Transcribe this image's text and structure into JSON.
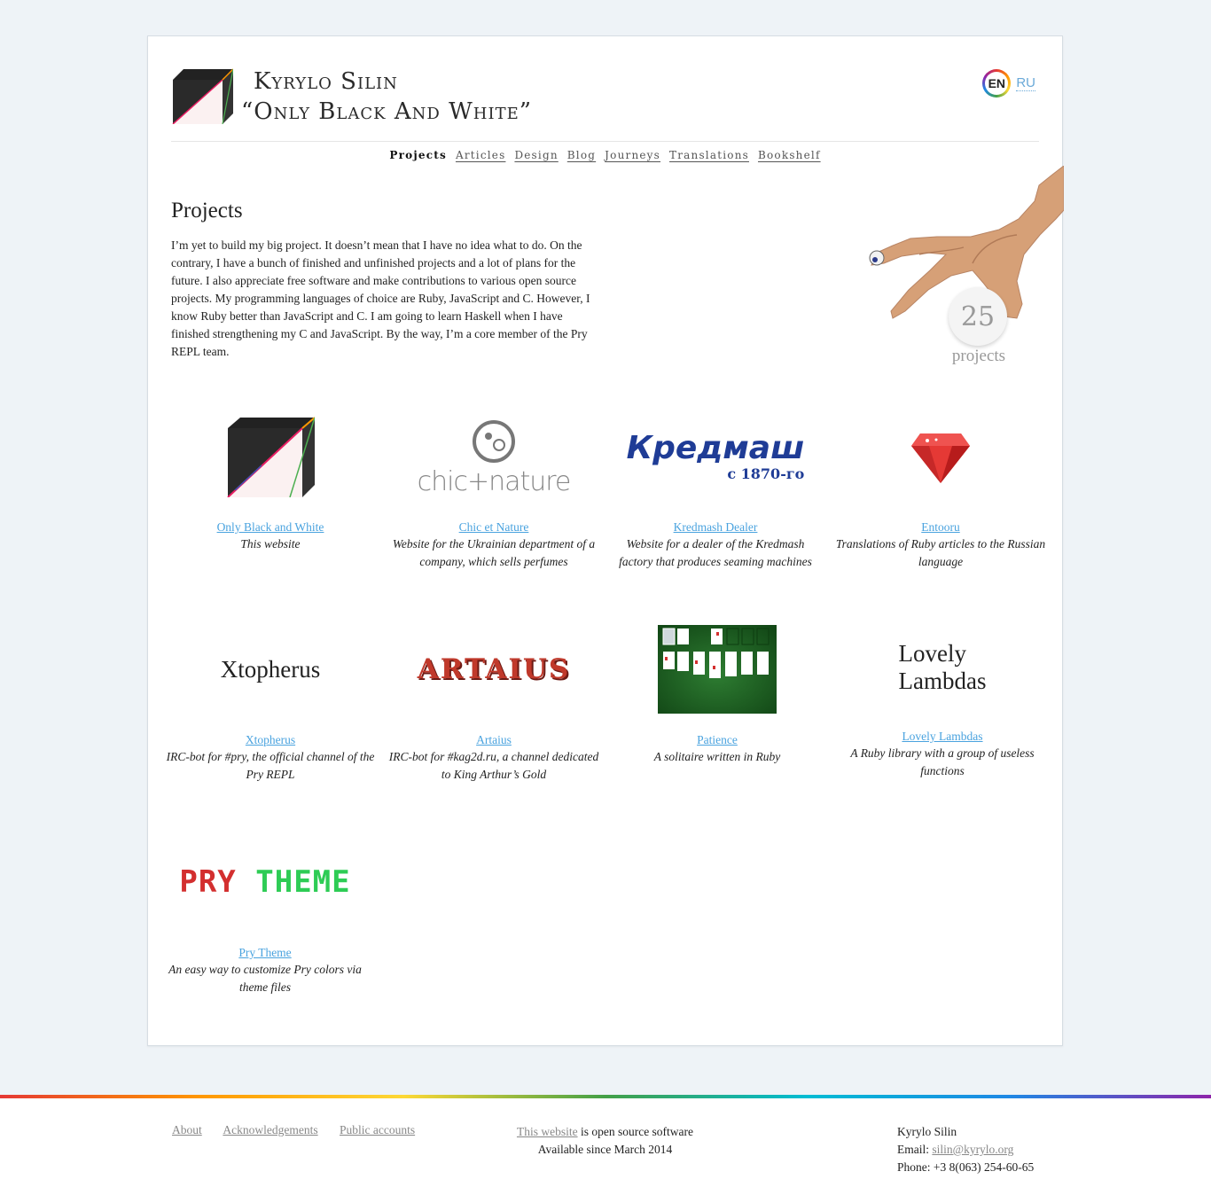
{
  "header": {
    "name": "Kyrylo Silin",
    "tagline": "“Only Black And White”",
    "lang_active": "EN",
    "lang_other": "RU"
  },
  "nav": [
    "Projects",
    "Articles",
    "Design",
    "Blog",
    "Journeys",
    "Translations",
    "Bookshelf"
  ],
  "main": {
    "title": "Projects",
    "intro": "I’m yet to build my big project. It doesn’t mean that I have no idea what to do. On the contrary, I have a bunch of finished and unfinished projects and a lot of plans for the future. I also appreciate free software and make contributions to various open source projects. My programming languages of choice are Ruby, JavaScript and C. However, I know Ruby better than JavaScript and C. I am going to learn Haskell when I have finished strengthening my C and JavaScript. By the way, I’m a core member of the Pry REPL team.",
    "project_count": "25",
    "project_count_label": "projects"
  },
  "projects": [
    {
      "title": "Only Black and White",
      "desc": "This website"
    },
    {
      "title": "Chic et Nature",
      "desc": "Website for the Ukrainian department of a company, which sells perfumes",
      "logo_text": "chic+nature"
    },
    {
      "title": "Kredmash Dealer",
      "desc": "Website for a dealer of the Kredmash factory that produces seaming machines",
      "logo_text": "Кредмаш",
      "logo_sub": "с 1870-го"
    },
    {
      "title": "Entooru",
      "desc": "Translations of Ruby articles to the Russian language"
    },
    {
      "title": "Xtopherus",
      "desc": "IRC-bot for #pry, the official channel of the Pry REPL",
      "logo_text": "Xtopherus"
    },
    {
      "title": "Artaius",
      "desc": "IRC-bot for #kag2d.ru, a channel dedicated to King Arthur’s Gold",
      "logo_text": "ARTAIUS"
    },
    {
      "title": "Patience",
      "desc": "A solitaire written in Ruby"
    },
    {
      "title": "Lovely Lambdas",
      "desc": "A Ruby library with a group of useless functions",
      "logo_line1": "Lovely",
      "logo_line2": "Lambdas"
    },
    {
      "title": "Pry Theme",
      "desc": "An easy way to customize Pry colors via theme files",
      "logo_word1": "PRY",
      "logo_word2": "THEME"
    }
  ],
  "footer": {
    "links": [
      "About",
      "Acknowledgements",
      "Public accounts"
    ],
    "source_link": "This website",
    "source_text": " is open source software",
    "since": "Available since March 2014",
    "contact_name": "Kyrylo Silin",
    "email_label": "Email: ",
    "email": "silin@kyrylo.org",
    "phone": "Phone: +3 8(063) 254-60-65"
  },
  "colors": {
    "link": "#4aa3df",
    "background": "#eef3f7",
    "artaius_red": "#c0392b",
    "pry_red": "#d32f2f",
    "pry_green": "#2ecc55"
  }
}
